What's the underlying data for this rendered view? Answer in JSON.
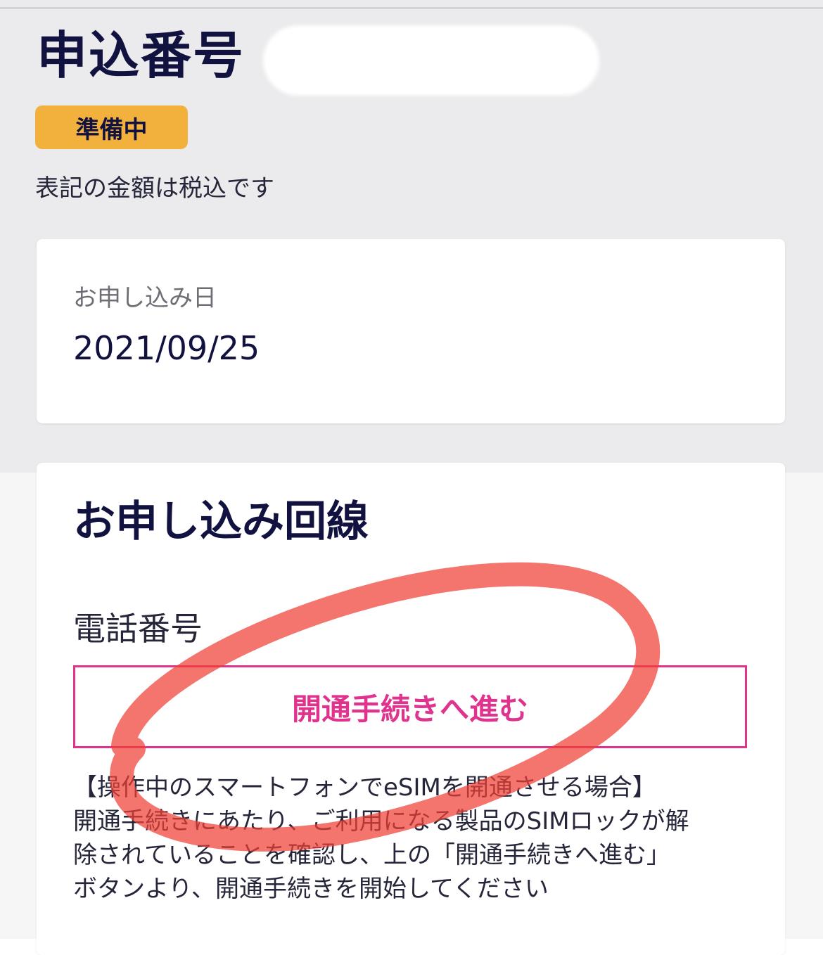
{
  "header": {
    "title": "申込番号",
    "status_badge": "準備中",
    "tax_note": "表記の金額は税込です"
  },
  "application_date": {
    "label": "お申し込み日",
    "value": "2021/09/25"
  },
  "line_section": {
    "title": "お申し込み回線",
    "phone_label": "電話番号",
    "activate_button": "開通手続きへ進む",
    "notice_lines": [
      "【操作中のスマートフォンでeSIMを開通させる場合】",
      "開通手続きにあたり、ご利用になる製品のSIMロックが解",
      "除されていることを確認し、上の「開通手続きへ進む」",
      "ボタンより、開通手続きを開始してください"
    ]
  },
  "colors": {
    "accent_pink": "#e0338d",
    "badge_yellow": "#f2b13d",
    "annotation_red": "#ee4035"
  }
}
